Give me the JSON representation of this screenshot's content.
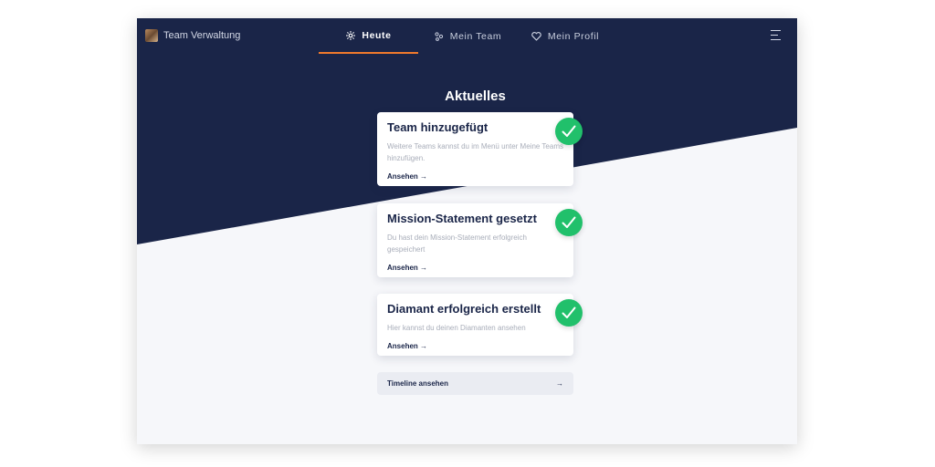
{
  "app": {
    "name": "Team Verwaltung"
  },
  "nav": {
    "items": [
      {
        "label": "Heute",
        "icon": "sun-icon",
        "active": true
      },
      {
        "label": "Mein Team",
        "icon": "team-icon",
        "active": false
      },
      {
        "label": "Mein Profil",
        "icon": "heart-icon",
        "active": false
      }
    ],
    "menu_icon": "hamburger-menu-icon"
  },
  "main": {
    "heading": "Aktuelles",
    "cards": [
      {
        "title": "Team hinzugefügt",
        "description": "Weitere Teams kannst du im Menü unter Meine Teams hinzufügen.",
        "link": "Ansehen →",
        "status_icon": "check-icon"
      },
      {
        "title": "Mission-Statement gesetzt",
        "description": "Du hast dein Mission-Statement erfolgreich gespeichert",
        "link": "Ansehen →",
        "status_icon": "check-icon"
      },
      {
        "title": "Diamant erfolgreich erstellt",
        "description": "Hier kannst du deinen Diamanten ansehen",
        "link": "Ansehen →",
        "status_icon": "check-icon"
      }
    ],
    "timeline": {
      "label": "Timeline ansehen",
      "arrow": "→"
    }
  },
  "colors": {
    "navy": "#1a2548",
    "accent": "#f07a2c",
    "success": "#21c06b",
    "background": "#f6f7fa"
  }
}
